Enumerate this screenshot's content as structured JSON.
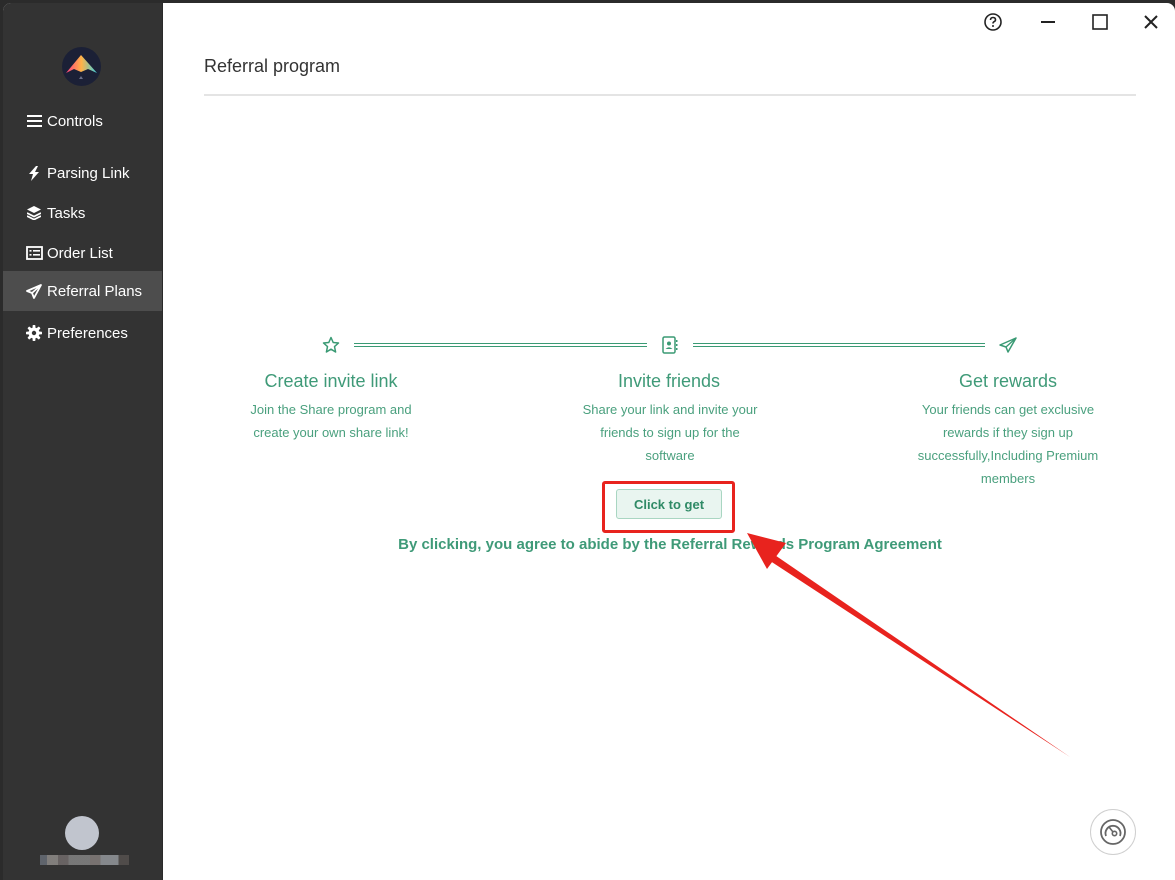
{
  "sidebar": {
    "logo": "mountain-logo",
    "items": [
      {
        "label": "Controls",
        "icon": "menu-icon",
        "active": false
      },
      {
        "label": "Parsing Link",
        "icon": "bolt-icon",
        "active": false
      },
      {
        "label": "Tasks",
        "icon": "layers-icon",
        "active": false
      },
      {
        "label": "Order List",
        "icon": "list-icon",
        "active": false
      },
      {
        "label": "Referral Plans",
        "icon": "paper-plane-icon",
        "active": true
      },
      {
        "label": "Preferences",
        "icon": "gear-icon",
        "active": false
      }
    ],
    "user": {
      "avatar": "avatar",
      "name_redacted": true
    }
  },
  "titlebar": {
    "help": "help-icon",
    "minimize": "minimize-icon",
    "maximize": "maximize-icon",
    "close": "close-icon"
  },
  "page": {
    "title": "Referral program",
    "steps": [
      {
        "icon": "star-icon",
        "title": "Create invite link",
        "desc": "Join the Share program and create your own share link!"
      },
      {
        "icon": "contact-book-icon",
        "title": "Invite friends",
        "desc": "Share your link and invite your friends to sign up for the software"
      },
      {
        "icon": "paper-plane-icon",
        "title": "Get rewards",
        "desc": "Your friends can get exclusive rewards if they sign up successfully,Including Premium members"
      }
    ],
    "cta_label": "Click to get",
    "agreement": "By clicking, you agree to abide by the Referral Rewards Program Agreement"
  },
  "colors": {
    "accent": "#3f9a78",
    "sidebar_bg": "#333333",
    "sidebar_active": "#4d4d4d",
    "annotation": "#e8231e"
  }
}
